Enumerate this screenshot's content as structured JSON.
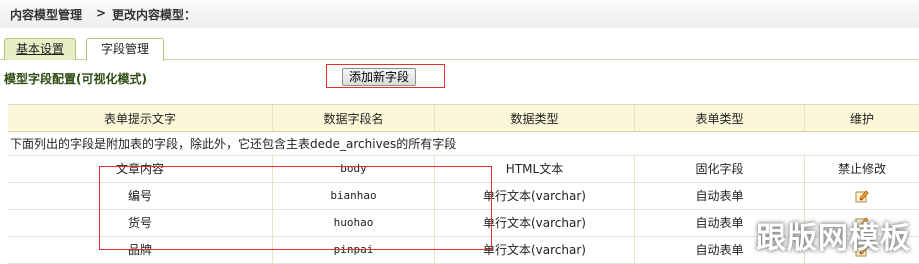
{
  "breadcrumb": {
    "root": "内容模型管理",
    "separator": ">",
    "current": "更改内容模型："
  },
  "tabs": [
    {
      "label": "基本设置"
    },
    {
      "label": "字段管理"
    }
  ],
  "section": {
    "title": "模型字段配置(可视化模式)",
    "add_button": "添加新字段"
  },
  "table": {
    "headers": [
      "表单提示文字",
      "数据字段名",
      "数据类型",
      "表单类型",
      "维护"
    ],
    "note": "下面列出的字段是附加表的字段，除此外，它还包含主表dede_archives的所有字段",
    "rows": [
      {
        "label": "文章内容",
        "field": "body",
        "dtype": "HTML文本",
        "form": "固化字段",
        "action": "禁止修改",
        "icon": "edit-icon"
      },
      {
        "label": "编号",
        "field": "bianhao",
        "dtype": "单行文本(varchar)",
        "form": "自动表单",
        "icon": "edit-icon"
      },
      {
        "label": "货号",
        "field": "huohao",
        "dtype": "单行文本(varchar)",
        "form": "自动表单",
        "icon": "edit-icon"
      },
      {
        "label": "品牌",
        "field": "pinpai",
        "dtype": "单行文本(varchar)",
        "form": "自动表单",
        "icon": "edit-icon"
      }
    ]
  },
  "watermark": "跟版网模板",
  "colors": {
    "annotation_red": "#e03030",
    "header_bg": "#fbf7d8",
    "tab_active_bg": "#e7edc5"
  }
}
